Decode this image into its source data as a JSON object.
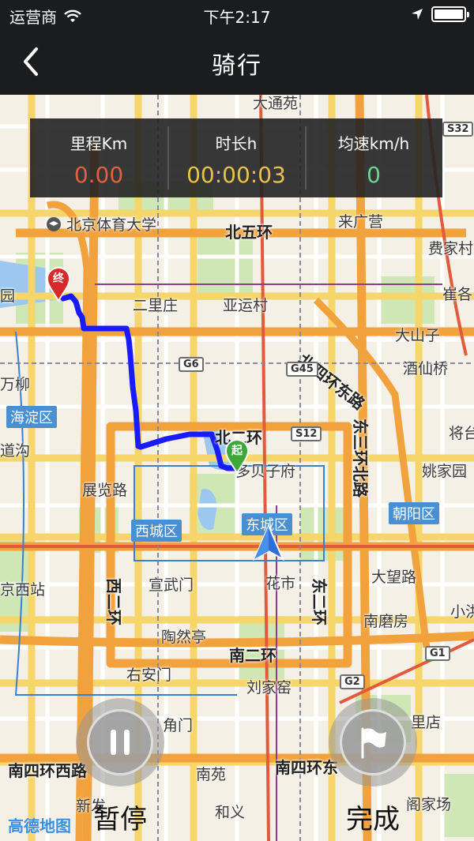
{
  "status_bar": {
    "carrier": "运营商",
    "time": "下午2:17"
  },
  "nav": {
    "title": "骑行"
  },
  "stats": {
    "distance_label": "里程Km",
    "distance_value": "0.00",
    "duration_label": "时长h",
    "duration_value": "00:00:03",
    "speed_label": "均速km/h",
    "speed_value": "0"
  },
  "map": {
    "labels": {
      "datongyuan": "大通苑",
      "bsu": "北京体育大学",
      "north5": "北五环",
      "laiguangying": "来广营",
      "feijiacun": "费家村",
      "cuige": "崔各",
      "yuan": "园",
      "erlizhuang": "二里庄",
      "yayuncun": "亚运村",
      "north4east": "北四环东路",
      "dashanzi": "大山子",
      "jiuxianqiao": "酒仙桥",
      "liu": "万柳",
      "haidian": "海淀区",
      "daogou": "道沟",
      "north2": "北二环",
      "duobeizi": "多贝子府",
      "east3north": "东三环北路",
      "jiangtai": "将台",
      "yaojiayuan": "姚家园",
      "zhanlanlu": "展览路",
      "xicheng": "西城区",
      "dongcheng": "东城区",
      "chaoyang": "朝阳区",
      "xuanwumen": "宣武门",
      "huashi": "花市",
      "xizhan": "京西站",
      "west2": "西二环",
      "east2": "东二环",
      "dawanglu": "大望路",
      "taoranting": "陶然亭",
      "nanmofang": "南磨房",
      "xiaohong": "小洪",
      "south2": "南二环",
      "youanmen": "右安门",
      "liujiayao": "刘家窑",
      "jiaomen": "角门",
      "lidian": "里店",
      "south4west": "南四环西路",
      "nanyuan": "南苑",
      "south4east": "南四环东",
      "xinfa": "新发",
      "heyi": "和义",
      "gejiachang": "阁家场",
      "start": "起",
      "end": "终"
    },
    "shields": {
      "s32": "S32",
      "g6": "G6",
      "g45": "G45",
      "s12": "S12",
      "g1": "G1",
      "g2": "G2"
    }
  },
  "controls": {
    "pause_label": "暂停",
    "finish_label": "完成"
  },
  "logo": "高德地图",
  "colors": {
    "route": "#1a1aff",
    "distance": "#e0613c",
    "duration": "#e8c24a",
    "speed": "#6fd38a",
    "district": "#4a8fd1"
  }
}
